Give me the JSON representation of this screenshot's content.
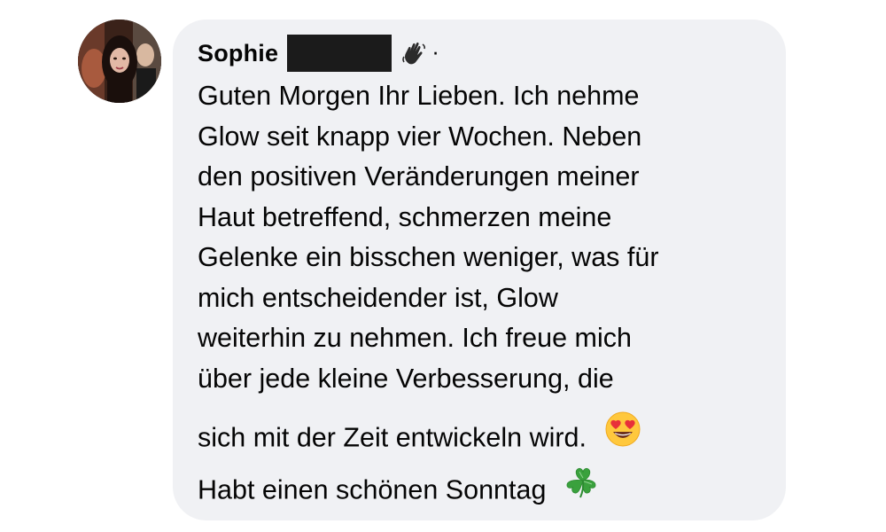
{
  "comment": {
    "author_name": "Sophie",
    "author_badge_icon": "waving-hand-icon",
    "name_separator": "·",
    "lines": [
      "Guten Morgen Ihr Lieben. Ich nehme",
      "Glow seit knapp vier Wochen. Neben",
      "den positiven Veränderungen meiner",
      "Haut betreffend, schmerzen meine",
      "Gelenke ein bisschen weniger, was für",
      "mich entscheidender ist, Glow",
      "weiterhin zu nehmen. Ich freue mich",
      "über jede kleine Verbesserung, die",
      "sich mit der Zeit entwickeln wird.",
      "Habt einen schönen Sonntag"
    ],
    "emoji_1": "heart-eyes-emoji-icon",
    "emoji_2": "four-leaf-clover-icon"
  },
  "colors": {
    "bubble_bg": "#f0f1f4",
    "text": "#050505",
    "redaction": "#1b1b1b",
    "clover": "#3aa13d",
    "emoji_face": "#ffc83d",
    "emoji_heart": "#e8303a"
  }
}
